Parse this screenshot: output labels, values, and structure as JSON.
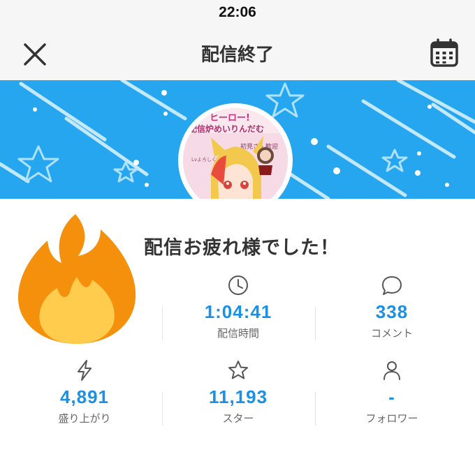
{
  "status_bar": {
    "time": "22:06"
  },
  "nav": {
    "title": "配信終了"
  },
  "main": {
    "message": "配信お疲れ様でした！"
  },
  "stats": [
    {
      "icon": "clock-icon",
      "value": "1:04:41",
      "label": "配信時間"
    },
    {
      "icon": "comment-icon",
      "value": "338",
      "label": "コメント"
    },
    {
      "icon": "lightning-icon",
      "value": "4,891",
      "label": "盛り上がり"
    },
    {
      "icon": "star-icon",
      "value": "11,193",
      "label": "スター"
    },
    {
      "icon": "person-icon",
      "value": "-",
      "label": "フォロワー"
    }
  ],
  "avatar": {
    "text_lines": [
      "ヒーロー!",
      "配信炉めいりんだむ",
      "初見さん歓迎",
      "Lvよろしくお願いします"
    ]
  },
  "colors": {
    "accent": "#1a90e6",
    "banner": "#26a6ef",
    "fire_outer": "#f4900c",
    "fire_inner": "#ffcc4d"
  }
}
